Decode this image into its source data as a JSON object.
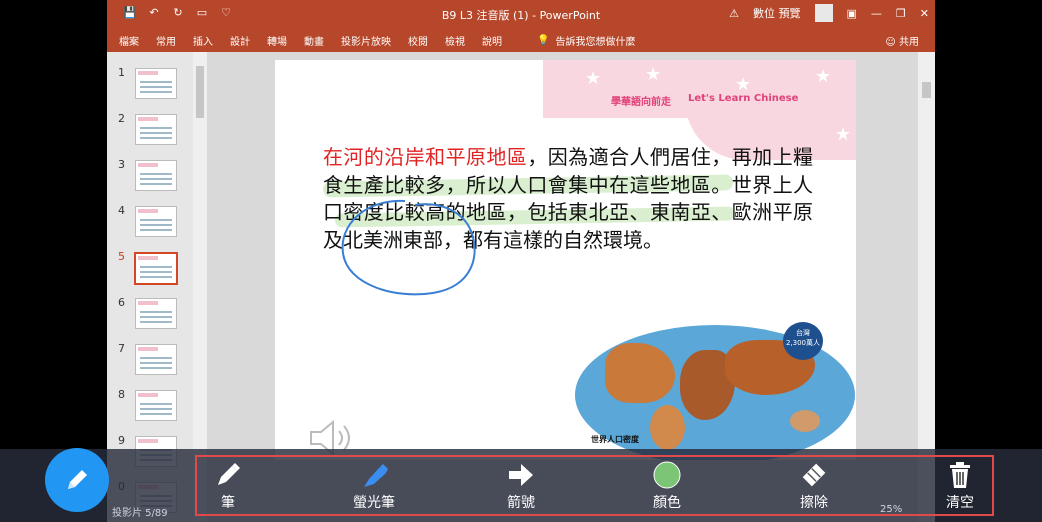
{
  "app": {
    "window_title": "B9 L3 注音版 (1)  -  PowerPoint",
    "warning_label": "數位 預覽",
    "ribbon_tabs": [
      "檔案",
      "常用",
      "插入",
      "設計",
      "轉場",
      "動畫",
      "投影片放映",
      "校閱",
      "檢視",
      "說明"
    ],
    "tell_me": "告訴我您想做什麼",
    "share_label": "共用"
  },
  "thumbnails": [
    {
      "num": "1",
      "active": false
    },
    {
      "num": "2",
      "active": false
    },
    {
      "num": "3",
      "active": false
    },
    {
      "num": "4",
      "active": false
    },
    {
      "num": "5",
      "active": true
    },
    {
      "num": "6",
      "active": false
    },
    {
      "num": "7",
      "active": false
    },
    {
      "num": "8",
      "active": false
    },
    {
      "num": "9",
      "active": false
    },
    {
      "num": "0",
      "active": false
    }
  ],
  "slide": {
    "header_cn": "學華語向前走",
    "header_en": "Let's Learn Chinese",
    "body_red": "在河的沿岸和平原地區",
    "body_rest": "，因為適合人們居住，再加上糧食生產比較多，所以人口會集中在這些地區。世界上人口密度比較高的地區，包括東北亞、東南亞、歐洲平原及北美洲東部，都有這樣的自然環境。",
    "map_label": "世界人口密度",
    "pin_line1": "台灣",
    "pin_line2": "2,300萬人"
  },
  "status": {
    "left": "投影片 5/89",
    "right": "25%"
  },
  "toolbar": {
    "pen": "筆",
    "highlighter": "螢光筆",
    "arrow": "箭號",
    "color": "顏色",
    "eraser": "擦除",
    "clear": "清空",
    "color_value": "#7cc576",
    "fab_color": "#2196f3",
    "frame_color": "#e04a4a"
  }
}
